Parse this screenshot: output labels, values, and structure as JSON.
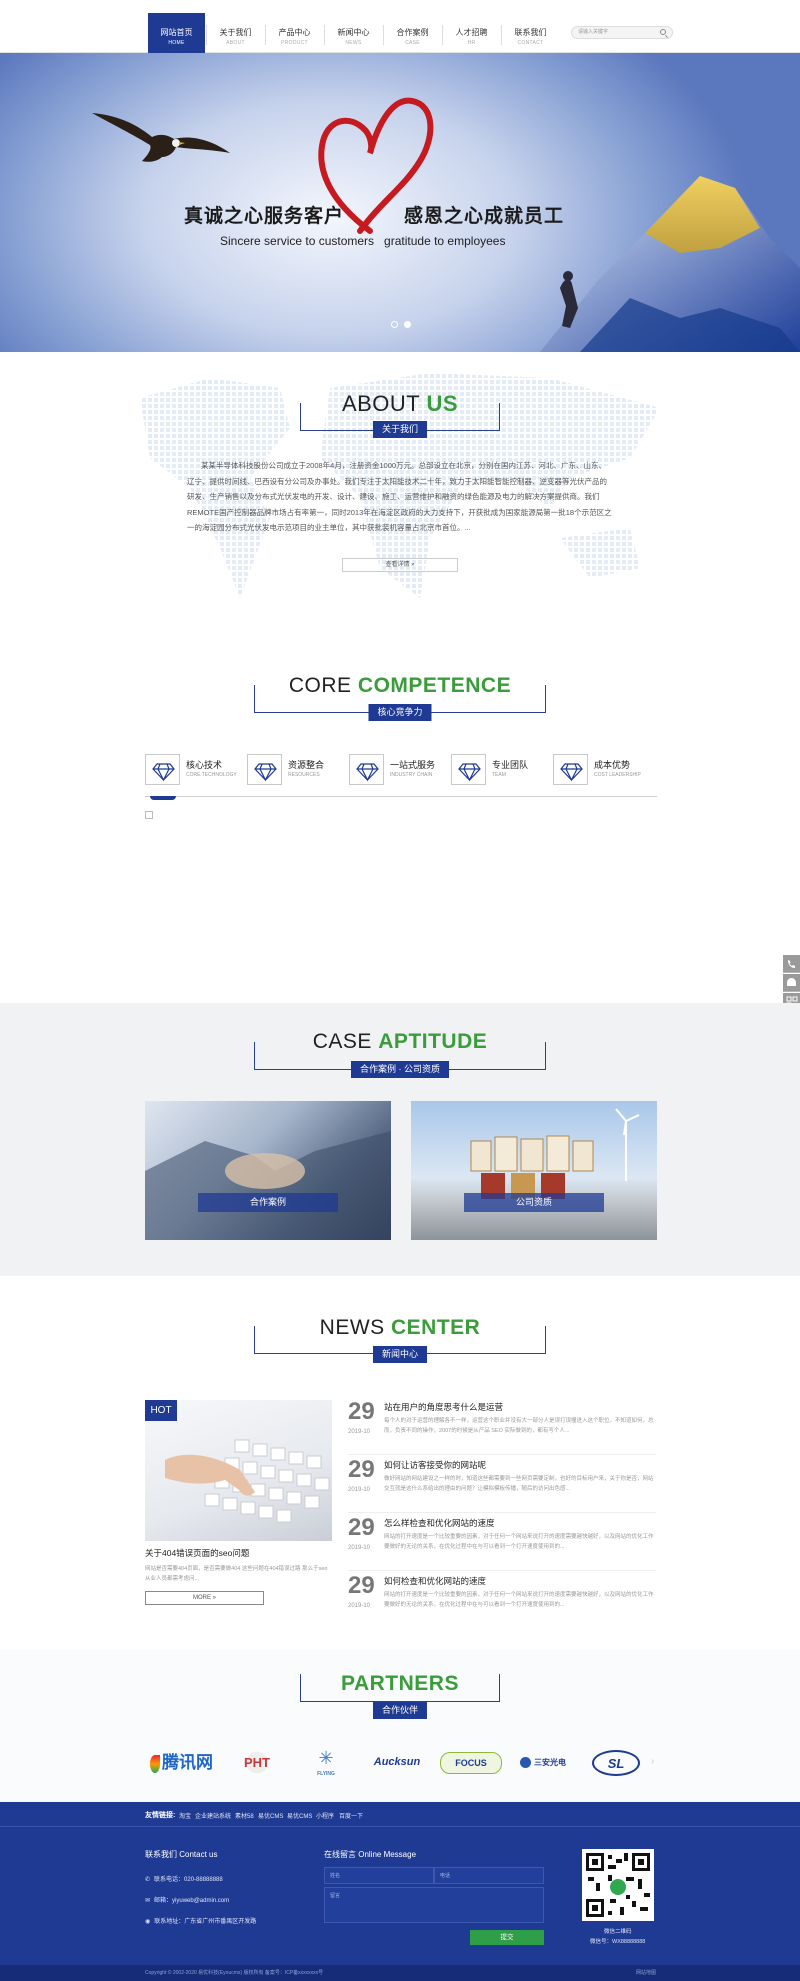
{
  "nav": {
    "items": [
      {
        "zh": "网站首页",
        "en": "HOME",
        "active": true
      },
      {
        "zh": "关于我们",
        "en": "ABOUT",
        "active": false
      },
      {
        "zh": "产品中心",
        "en": "PRODUCT",
        "active": false
      },
      {
        "zh": "新闻中心",
        "en": "NEWS",
        "active": false
      },
      {
        "zh": "合作案例",
        "en": "CASE",
        "active": false
      },
      {
        "zh": "人才招聘",
        "en": "HR",
        "active": false
      },
      {
        "zh": "联系我们",
        "en": "CONTACT",
        "active": false
      }
    ],
    "search_placeholder": "请输入关键字",
    "search_icon": "search-icon"
  },
  "banner": {
    "title_left": "真诚之心服务客户",
    "title_right": "感恩之心成就员工",
    "subtitle": "Sincere service to customers   gratitude to employees",
    "slide_count": 2,
    "active_slide": 2
  },
  "about": {
    "title_a": "ABOUT",
    "title_b": "US",
    "tag": "关于我们",
    "text": "某某半导体科技股份公司成立于2008年4月，注册资金1000万元。总部设立在北京，分别在国内江苏、河北、广东、山东、辽宁、提供时间线、巴西设有分公司及办事处。我们专注于太阳能技术二十年，致力于太阳能智能控制器、逆变器等光伏产品的研发、生产销售以及分布式光伏发电的开发、设计、建设、施工、运营维护和融资的绿色能源及电力的解决方案提供商。我们REMOTE国产控制器品牌市场占有率第一，同时2013年在海淀区政府的大力支持下，开获批成为国家能源局第一批18个示范区之一的海淀园分布式光伏发电示范项目的业主单位，其中获批装机容量占北京市首位。...",
    "more": "查看详情 »"
  },
  "competence": {
    "title_a": "CORE",
    "title_b": "COMPETENCE",
    "tag": "核心竞争力",
    "items": [
      {
        "zh": "核心技术",
        "en": "CORE TECHNOLOGY"
      },
      {
        "zh": "资源整合",
        "en": "RESOURCES"
      },
      {
        "zh": "一站式服务",
        "en": "INDUSTRY CHAIN"
      },
      {
        "zh": "专业团队",
        "en": "TEAM"
      },
      {
        "zh": "成本优势",
        "en": "COST LEADERSHIP"
      }
    ]
  },
  "cases": {
    "title_a": "CASE",
    "title_b": "APTITUDE",
    "tag": "合作案例 · 公司资质",
    "items": [
      {
        "label": "合作案例"
      },
      {
        "label": "公司资质"
      }
    ]
  },
  "news": {
    "title_a": "NEWS",
    "title_b": "CENTER",
    "tag": "新闻中心",
    "hot_badge": "HOT",
    "featured_title": "关于404错误页面的seo问题",
    "featured_desc": "网站是否需要404页面，是否需要做404 这些问题在404错误过路 那么于seo从业人员都需考虑问...",
    "featured_more": "MORE »",
    "list": [
      {
        "day": "29",
        "ym": "2019-10",
        "title": "站在用户的角度思考什么是运营",
        "desc": "每个人的对于运营的理解各不一样，运营这个职业并没有大一部分人是误打误撞进入这个职位，不知道如何，总而，负责不同的操作，2007的时候是从产品 SEO 实际做到的，都有写个人..."
      },
      {
        "day": "29",
        "ym": "2019-10",
        "title": "如何让访客接受你的网站呢",
        "desc": "做好网站的网站建设之一样的时，知道这些都需要到一些网页需要定制，也好的目标用户来，关于你是否，网站交互就是这什么系给出的理由的问题？让模拟模板传播，随后的访问出色感..."
      },
      {
        "day": "29",
        "ym": "2019-10",
        "title": "怎么样检查和优化网站的速度",
        "desc": "网站的打开速度是一个比较重要的因素，对于任何一个网站来说打开的速度需要越快越好，以及网站的优化工作要做好的无论的关系，在优化过程中在与可以看到一个打开速度使用到的..."
      },
      {
        "day": "29",
        "ym": "2019-10",
        "title": "如何检查和优化网站的速度",
        "desc": "网站的打开速度是一个比较重要的因素，对于任何一个网站来说打开的速度需要越快越好，以及网站的优化工作要做好的无论的关系，在优化过程中在与可以看到一个打开速度使用到的..."
      }
    ]
  },
  "partners": {
    "title": "PARTNERS",
    "tag": "合作伙伴",
    "logos": [
      "腾讯网",
      "PHT",
      "FLYING",
      "Aucksun",
      "FOCUS",
      "三安光电",
      "SL"
    ]
  },
  "footer": {
    "links_label": "友情链接:",
    "links": [
      "淘宝",
      "企业建站系统",
      "素材58",
      "易优CMS",
      "易优CMS",
      "小程序",
      "百度一下"
    ],
    "contact_title": "联系我们 Contact us",
    "phone": "联系电话：020-88888888",
    "email": "邮箱：yiyuweb@admin.com",
    "address": "联系地址：广东省广州市番禺区开发路",
    "message_title": "在线留言 Online Message",
    "name_placeholder": "姓名",
    "phone_placeholder": "电话",
    "content_placeholder": "留言",
    "submit": "提交",
    "qr_caption": "微信二维码",
    "wechat": "微信号：WX88888888",
    "copyright": "Copyright © 2002-2020 易优科技(Eyoucms) 版权所有   备案号：ICP备xxxxxxxx号",
    "sitemap": "网站地图"
  }
}
